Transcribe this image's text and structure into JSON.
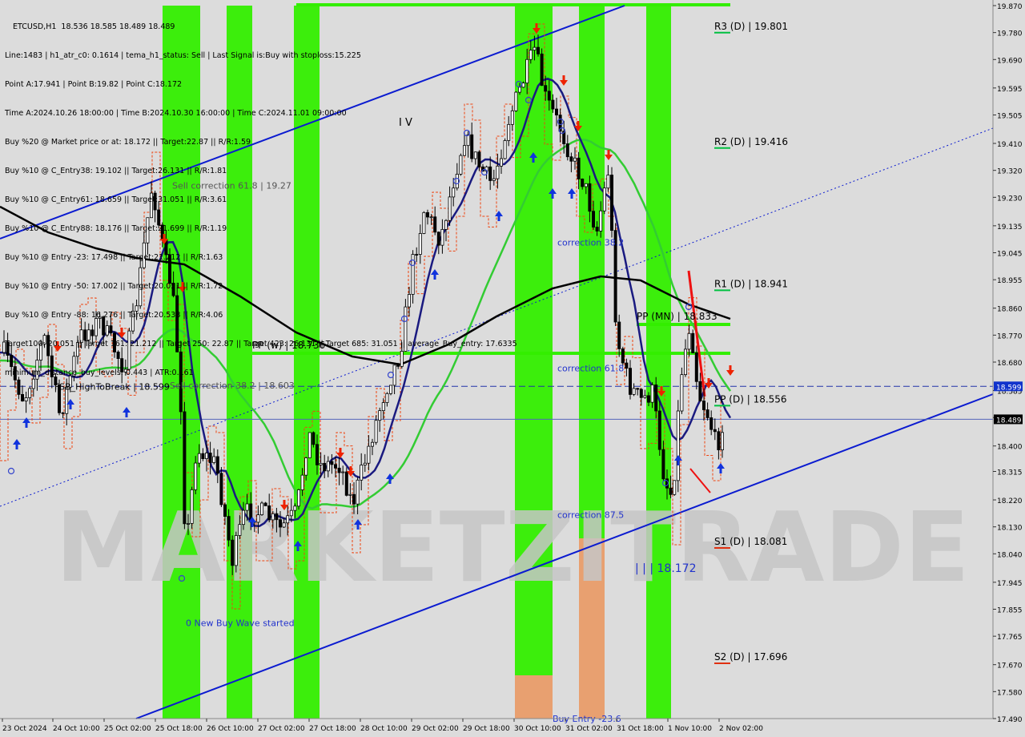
{
  "symbol_header": "ETCUSD,H1  18.536 18.585 18.489 18.489",
  "info_lines": [
    "Line:1483 | h1_atr_c0: 0.1614 | tema_h1_status: Sell | Last Signal is:Buy with stoploss:15.225",
    "Point A:17.941 | Point B:19.82 | Point C:18.172",
    "Time A:2024.10.26 18:00:00 | Time B:2024.10.30 16:00:00 | Time C:2024.11.01 09:00:00",
    "Buy %20 @ Market price or at: 18.172 || Target:22.87 || R/R:1.59",
    "Buy %10 @ C_Entry38: 19.102 || Target:26.131 || R/R:1.81",
    "Buy %10 @ C_Entry61: 18.659 || Target:31.051 || R/R:3.61",
    "Buy %10 @ C_Entry88: 18.176 || Target:21.699 || R/R:1.19",
    "Buy %10 @ Entry -23: 17.498 || Target:21.212 || R/R:1.63",
    "Buy %10 @ Entry -50: 17.002 || Target:20.051 || R/R:1.72",
    "Buy %10 @ Entry -88: 16.276 || Target:20.538 || R/R:4.06",
    "Target100: 20.051 || Target 161: 21.212 || Target 250: 22.87 || Target 423: 26.131 || Target 685: 31.051 || average_Buy_entry: 17.6335",
    "minimum_distance_buy_levels: 0.443 | ATR:0.161"
  ],
  "chart_data": {
    "type": "candlestick",
    "symbol": "ETCUSD",
    "timeframe": "H1",
    "y_ticks": [
      19.87,
      19.78,
      19.69,
      19.595,
      19.505,
      19.41,
      19.32,
      19.23,
      19.135,
      19.045,
      18.955,
      18.86,
      18.77,
      18.68,
      18.585,
      18.495,
      18.4,
      18.315,
      18.22,
      18.13,
      18.04,
      17.945,
      17.855,
      17.765,
      17.67,
      17.58,
      17.49
    ],
    "ylim": [
      17.49,
      19.87
    ],
    "x_tick_labels": [
      "23 Oct 2024",
      "24 Oct 10:00",
      "25 Oct 02:00",
      "25 Oct 18:00",
      "26 Oct 10:00",
      "27 Oct 02:00",
      "27 Oct 18:00",
      "28 Oct 10:00",
      "29 Oct 02:00",
      "29 Oct 18:00",
      "30 Oct 10:00",
      "31 Oct 02:00",
      "31 Oct 18:00",
      "1 Nov 10:00",
      "2 Nov 02:00"
    ],
    "current_price": {
      "label": "18.489",
      "value": 18.489
    },
    "dashed_level": {
      "label": "18.599",
      "value": 18.599
    },
    "pivot_levels": [
      {
        "label": "R3 (D) | 19.801",
        "value": 19.801,
        "color": "#00c040"
      },
      {
        "label": "R2 (D) | 19.416",
        "value": 19.416,
        "color": "#00c040"
      },
      {
        "label": "R1 (D) | 18.941",
        "value": 18.941,
        "color": "#00c040"
      },
      {
        "label": "PP (D) | 18.556",
        "value": 18.556,
        "color": "#00c040"
      },
      {
        "label": "S1 (D) | 18.081",
        "value": 18.081,
        "color": "#e03010"
      },
      {
        "label": "S2 (D) | 17.696",
        "value": 17.696,
        "color": "#e03010"
      }
    ],
    "annotations": [
      {
        "label": "PP (w) | 18.736",
        "value": 18.736,
        "color": "#000000"
      },
      {
        "label": "PP (MN) | 18.833",
        "value": 18.833,
        "color": "#000000"
      },
      {
        "label": "Sell correction 61.8 | 19.27",
        "value": 19.27,
        "color": "#555555"
      },
      {
        "label": "Sell correction 38.2 | 18.603",
        "value": 18.603,
        "color": "#555555"
      },
      {
        "label": "FSB_HighToBreak | 18.599",
        "value": 18.599,
        "color": "#000000"
      },
      {
        "label": "correction 38.2",
        "value": 19.08,
        "color": "#2233cc"
      },
      {
        "label": "correction 61.8",
        "value": 18.66,
        "color": "#2233cc"
      },
      {
        "label": "correction 87.5",
        "value": 18.17,
        "color": "#2233cc"
      },
      {
        "label": "| | | 18.172",
        "value": 17.99,
        "color": "#2233cc"
      },
      {
        "label": "0 New Buy Wave started",
        "value": 17.81,
        "color": "#2233cc"
      },
      {
        "label": "Buy Entry -23.6",
        "value": 17.49,
        "color": "#2233cc"
      },
      {
        "label": "I V",
        "value": 19.48,
        "color": "#000000"
      }
    ],
    "watermark": "MARKETZITRADE",
    "colors": {
      "background": "#dcdcdc",
      "bull": "#000000",
      "bear": "#000000",
      "ema_dark_blue": "#1a1a80",
      "ema_green": "#33cc33",
      "ma_black": "#000000",
      "channel": "#0b1bd0",
      "zone_green": "#33ee00",
      "zone_orange": "#e8a070",
      "signal_up": "#1133dd",
      "signal_down": "#ee2200"
    }
  }
}
